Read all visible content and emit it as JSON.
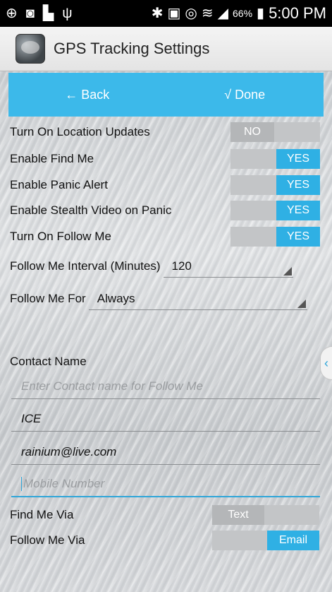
{
  "status_bar": {
    "battery": "66%",
    "time": "5:00 PM",
    "icons": [
      "notification-icon",
      "chat-icon",
      "image-icon",
      "usb-icon",
      "bluetooth-icon",
      "nfc-icon",
      "alarm-icon",
      "wifi-icon",
      "signal-icon",
      "battery-icon"
    ]
  },
  "app_bar": {
    "title": "GPS Tracking Settings"
  },
  "nav": {
    "back_label": "← Back",
    "done_label": "√ Done"
  },
  "settings": {
    "toggles": [
      {
        "label": "Turn On Location Updates",
        "value": "NO",
        "on": false
      },
      {
        "label": "Enable Find Me",
        "value": "YES",
        "on": true
      },
      {
        "label": "Enable Panic Alert",
        "value": "YES",
        "on": true
      },
      {
        "label": "Enable Stealth Video on Panic",
        "value": "YES",
        "on": true
      },
      {
        "label": "Turn On Follow Me",
        "value": "YES",
        "on": true
      }
    ],
    "interval": {
      "label": "Follow Me Interval (Minutes)",
      "value": "120"
    },
    "duration": {
      "label": "Follow Me For",
      "value": "Always"
    }
  },
  "contact": {
    "label": "Contact Name",
    "name_placeholder": "Enter Contact name for Follow Me",
    "name_value": "ICE",
    "email_value": "rainium@live.com",
    "mobile_placeholder": "Mobile Number"
  },
  "via": {
    "find_me": {
      "label": "Find Me Via",
      "value": "Text",
      "on": false
    },
    "follow_me": {
      "label": "Follow Me Via",
      "value": "Email",
      "on": true
    }
  }
}
